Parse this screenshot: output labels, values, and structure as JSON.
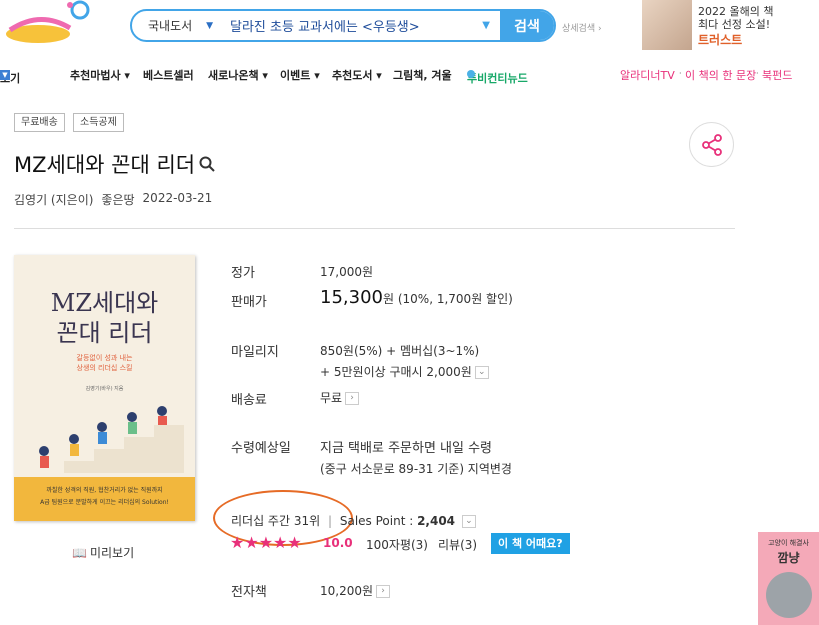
{
  "header": {
    "search": {
      "category": "국내도서",
      "query": "달라진 초등 교과서에는 <우등생>",
      "button": "검색"
    },
    "advanced_search": "상세검색 ›",
    "banner": {
      "line1": "2022 올해의 책",
      "line2": "최다 선정 소설!",
      "line3": "트러스트"
    }
  },
  "nav": {
    "items": [
      "보기",
      "추천마법사 ▾",
      "베스트셀러",
      "새로나온책 ▾",
      "이벤트 ▾",
      "추천도서 ▾",
      "그림책, 겨울",
      "투비컨티뉴드"
    ],
    "right": [
      "알라디너TV",
      "이 책의 한 문장",
      "북펀드"
    ]
  },
  "tags": [
    "무료배송",
    "소득공제"
  ],
  "book": {
    "title": "MZ세대와 꼰대 리더",
    "author": "김영기 (지은이)",
    "publisher": "좋은땅",
    "date": "2022-03-21",
    "cover": {
      "title1": "MZ세대와",
      "title2": "꼰대 리더",
      "sub1": "갈등없이 성과 내는",
      "sub2": "상생의 리더십 스킬",
      "author": "김영기(바우) 지음",
      "b1": "까칠한 성격의 직원, 협찬거리가 없는 직원까지",
      "b2": "A급 팀원으로 분발하게 이끄는 리더십의 Solution!"
    },
    "preview_label": "미리보기"
  },
  "info": {
    "list_label": "정가",
    "list_price": "17,000원",
    "sale_label": "판매가",
    "sale_price": "15,300",
    "sale_unit": "원",
    "discount": "(10%, 1,700원 할인)",
    "mileage_label": "마일리지",
    "mileage1": "850원(5%) + 멤버십(3~1%)",
    "mileage2": "+ 5만원이상 구매시 2,000원",
    "ship_label": "배송료",
    "ship_value": "무료",
    "delivery_label": "수령예상일",
    "delivery1": "지금 택배로 주문하면 내일 수령",
    "delivery2": "(중구 서소문로 89-31 기준) 지역변경",
    "rank_label": "리더십 주간 31위",
    "sales_point_label": "Sales Point :",
    "sales_point": "2,404",
    "rating": "10.0",
    "short_reviews": "100자평(3)",
    "reviews": "리뷰(3)",
    "how_button": "이 책 어때요?",
    "ebook_label": "전자책",
    "ebook_price": "10,200원"
  },
  "side_banner": {
    "t1": "고양이 해결사",
    "t2": "깜냥"
  }
}
